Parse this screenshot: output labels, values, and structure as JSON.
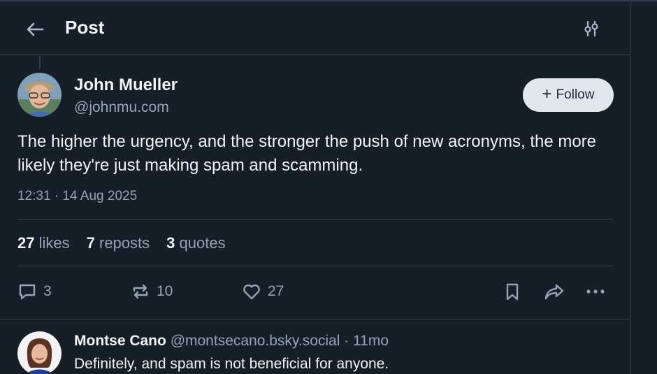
{
  "header": {
    "title": "Post"
  },
  "post": {
    "author_name": "John Mueller",
    "author_handle": "@johnmu.com",
    "follow_label": "Follow",
    "text": "The higher the urgency, and the stronger the push of new acronyms, the more likely they're just making spam and scamming.",
    "timestamp": "12:31 · 14 Aug 2025",
    "stats": {
      "likes_count": "27",
      "likes_label": "likes",
      "reposts_count": "7",
      "reposts_label": "reposts",
      "quotes_count": "3",
      "quotes_label": "quotes"
    },
    "actions": {
      "reply_count": "3",
      "repost_count": "10",
      "like_count": "27"
    }
  },
  "reply": {
    "author_name": "Montse Cano",
    "author_handle": "@montsecano.bsky.social",
    "age": "· 11mo",
    "text": "Definitely, and spam is not beneficial for anyone."
  },
  "colors": {
    "background": "#161e27",
    "border": "#2e4052",
    "text_primary": "#f1f3f5",
    "text_secondary": "#93a5b7",
    "follow_bg": "#e2e7ee"
  },
  "icons": {
    "back": "arrow-left-icon",
    "tune": "sliders-icon",
    "reply": "speech-bubble-icon",
    "repost": "repost-arrows-icon",
    "like": "heart-icon",
    "bookmark": "bookmark-icon",
    "share": "share-arrow-icon",
    "more": "ellipsis-icon"
  }
}
